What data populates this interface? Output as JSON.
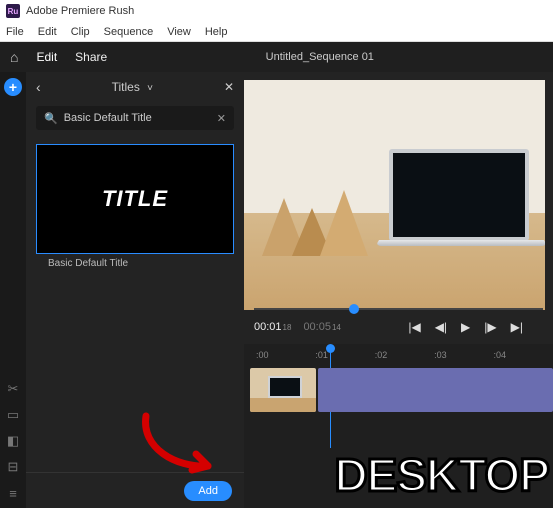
{
  "app": {
    "name": "Adobe Premiere Rush",
    "icon_label": "Ru"
  },
  "menus": {
    "file": "File",
    "edit": "Edit",
    "clip": "Clip",
    "sequence": "Sequence",
    "view": "View",
    "help": "Help"
  },
  "tabs": {
    "edit": "Edit",
    "share": "Share"
  },
  "document_title": "Untitled_Sequence 01",
  "panel": {
    "title": "Titles",
    "search_value": "Basic Default Title",
    "preset_thumb_text": "TITLE",
    "preset_caption": "Basic Default Title",
    "add_label": "Add"
  },
  "playback": {
    "current": "00:01",
    "current_frames": "18",
    "total": "00:05",
    "total_frames": "14"
  },
  "ruler": {
    "t0": ":00",
    "t1": ":01",
    "t2": ":02",
    "t3": ":03",
    "t4": ":04"
  },
  "overlay": {
    "desktop": "DESKTOP"
  },
  "icons": {
    "home": "⌂",
    "plus": "+",
    "back": "‹",
    "chev": "˅",
    "close": "✕",
    "search": "🔍",
    "clear": "✕",
    "prev": "|◀",
    "stepb": "◀|",
    "play": "▶",
    "stepf": "|▶",
    "next": "▶|",
    "scissors": "✂",
    "list": "≡"
  }
}
